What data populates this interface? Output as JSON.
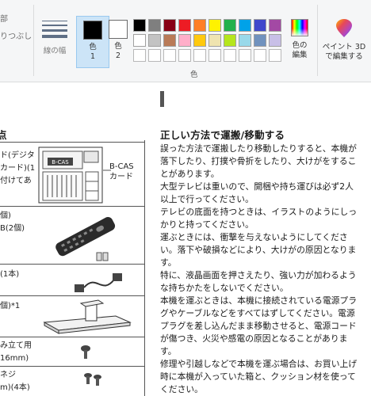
{
  "ribbon": {
    "left_partial_1": "部",
    "left_partial_2": "りつぶし",
    "line_width_label": "線の幅",
    "color1_label_a": "色",
    "color1_label_b": "1",
    "color2_label_a": "色",
    "color2_label_b": "2",
    "colors_group_label": "色",
    "edit_colors_a": "色の",
    "edit_colors_b": "編集",
    "paint3d_a": "ペイント 3D",
    "paint3d_b": "で編集する",
    "color1_value": "#000000",
    "color2_value": "#ffffff",
    "palette_row1": [
      "#000000",
      "#7f7f7f",
      "#880015",
      "#ed1c24",
      "#ff7f27",
      "#fff200",
      "#22b14c",
      "#00a2e8",
      "#3f48cc",
      "#a349a4"
    ],
    "palette_row2": [
      "#ffffff",
      "#c3c3c3",
      "#b97a57",
      "#ffaec9",
      "#ffc90e",
      "#efe4b0",
      "#b5e61d",
      "#99d9ea",
      "#7092be",
      "#c8bfe7"
    ]
  },
  "document": {
    "left_title": "点",
    "left_rows": [
      [
        "ド(デジタ",
        "カード)(1",
        "付けてあ"
      ],
      [
        "個)",
        "B(2個)"
      ],
      [
        "(1本)"
      ],
      [
        "個)*1"
      ],
      [
        "み立て用",
        "16mm)"
      ],
      [
        "ネジ",
        "m)(4本)"
      ]
    ],
    "bcas_label_1": "B-CAS",
    "bcas_label_2": "カード",
    "bcas_card_text": "B-CAS",
    "right_title": "正しい方法で運搬/移動する",
    "paragraphs": [
      "誤った方法で運搬したり移動したりすると、本機が落下したり、打撲や骨折をしたり、大けがをすることがあります。",
      "大型テレビは重いので、開梱や持ち運びは必ず2人以上で行ってください。",
      "テレビの底面を持つときは、イラストのようにしっかりと持ってください。",
      "運ぶときには、衝撃を与えないようにしてください。落下や破損などにより、大けがの原因となります。",
      "特に、液晶画面を押さえたり、強い力が加わるような持ちかたをしないでください。",
      "本機を運ぶときは、本機に接続されている電源プラグやケーブルなどをすべてはずしてください。電源プラグを差し込んだまま移動させると、電源コードが傷つき、火災や感電の原因となることがあります。",
      "修理や引越しなどで本機を運ぶ場合は、お買い上げ時に本機が入っていた箱と、クッション材を使ってください。"
    ]
  }
}
